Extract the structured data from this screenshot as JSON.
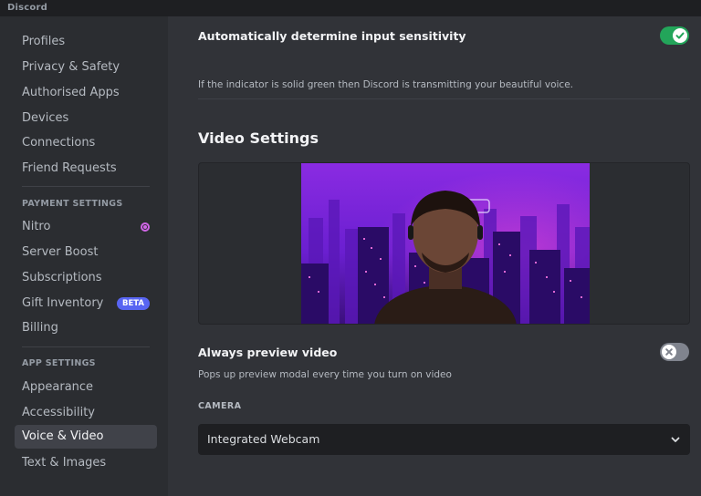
{
  "app": {
    "title": "Discord"
  },
  "sidebar": {
    "user_items": [
      "Profiles",
      "Privacy & Safety",
      "Authorised Apps",
      "Devices",
      "Connections",
      "Friend Requests"
    ],
    "payment_header": "PAYMENT SETTINGS",
    "payment_items": [
      "Nitro",
      "Server Boost",
      "Subscriptions",
      "Gift Inventory",
      "Billing"
    ],
    "beta_badge": "BETA",
    "app_header": "APP SETTINGS",
    "app_items": [
      "Appearance",
      "Accessibility",
      "Voice & Video",
      "Text & Images"
    ],
    "active_item": "Voice & Video"
  },
  "main": {
    "auto_sensitivity": {
      "title": "Automatically determine input sensitivity",
      "enabled": true,
      "help": "If the indicator is solid green then Discord is transmitting your beautiful voice."
    },
    "video_settings": {
      "heading": "Video Settings",
      "always_preview_title": "Always preview video",
      "always_preview_enabled": false,
      "always_preview_help": "Pops up preview modal every time you turn on video",
      "camera_header": "CAMERA",
      "camera_value": "Integrated Webcam"
    }
  },
  "colors": {
    "accent": "#5865f2",
    "toggle_on": "#23a55a",
    "toggle_off": "#80848e",
    "nitro": "#d066e6"
  },
  "icons": [
    "nitro-icon",
    "check-icon",
    "x-icon",
    "chevron-down-icon"
  ]
}
